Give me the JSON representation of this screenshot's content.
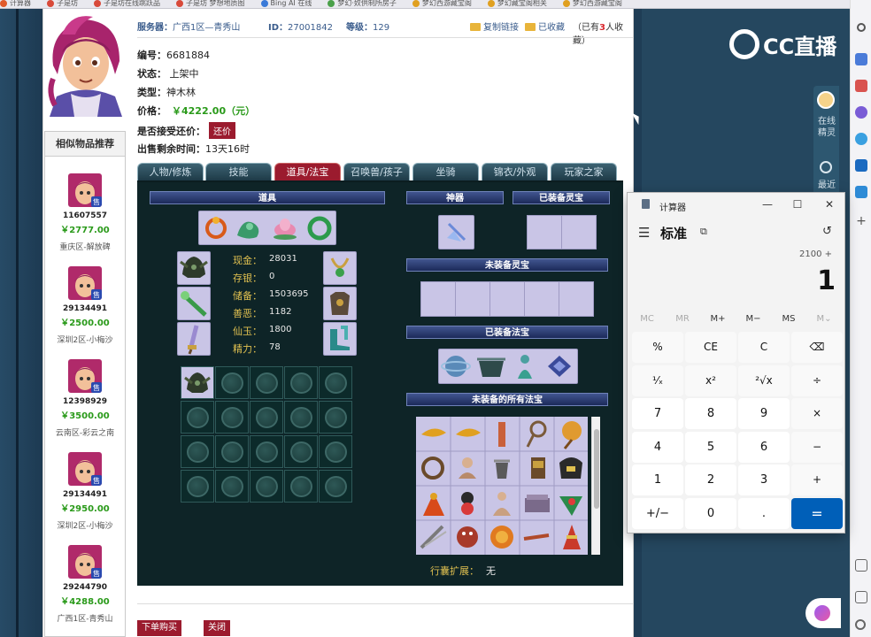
{
  "browser": {
    "bookmarks": [
      "计算器",
      "子是坊",
      "子是坊在线跳跃品",
      "子是坊 梦想地质图",
      "Bing AI 在线",
      "梦幻·奴供制所房子",
      "梦幻西游藏宝阁",
      "梦幻藏宝阁相关",
      "梦幻西游藏宝阁"
    ]
  },
  "listing": {
    "server_label": "服务器：",
    "server_value": "广西1区—青秀山",
    "id_label": "ID：",
    "id_value": "27001842",
    "level_label": "等级：",
    "level_value": "129",
    "copy_link": "复制链接",
    "favorited": "已收藏",
    "fav_prefix": "（已有",
    "fav_count": "3",
    "fav_suffix": "人收藏）",
    "serial_label": "编号：",
    "serial_value": "6681884",
    "status_label": "状态：",
    "status_value": "上架中",
    "type_label": "类型：",
    "type_value": "神木林",
    "price_label": "价格：",
    "price_value": "￥4222.00（元）",
    "counter_label": "是否接受还价：",
    "counter_button": "还价",
    "remain_label": "出售剩余时间：",
    "remain_value": "13天16时"
  },
  "recommend": {
    "title": "相似物品推荐",
    "badge": "售",
    "items": [
      {
        "id": "11607557",
        "price": "￥2777.00",
        "server": "重庆区-解放碑"
      },
      {
        "id": "29134491",
        "price": "￥2500.00",
        "server": "深圳2区-小梅沙"
      },
      {
        "id": "12398929",
        "price": "￥3500.00",
        "server": "云南区-彩云之南"
      },
      {
        "id": "29134491",
        "price": "￥2950.00",
        "server": "深圳2区-小梅沙"
      },
      {
        "id": "29244790",
        "price": "￥4288.00",
        "server": "广西1区-青秀山"
      }
    ]
  },
  "tabs": [
    "人物/修炼",
    "技能",
    "道具/法宝",
    "召唤兽/孩子",
    "坐骑",
    "锦衣/外观",
    "玩家之家"
  ],
  "active_tab": "道具/法宝",
  "game": {
    "items_bar": "道具",
    "shenqi_bar": "神器",
    "equipped_lingbao_bar": "已装备灵宝",
    "unequipped_lingbao_bar": "未装备灵宝",
    "equipped_fabao_bar": "已装备法宝",
    "all_fabao_bar": "未装备的所有法宝",
    "stats": [
      {
        "label": "现金：",
        "value": "28031"
      },
      {
        "label": "存银：",
        "value": "0"
      },
      {
        "label": "储备：",
        "value": "1503695"
      },
      {
        "label": "善恶：",
        "value": "1182"
      },
      {
        "label": "仙玉：",
        "value": "1800"
      },
      {
        "label": "精力：",
        "value": "78"
      }
    ],
    "ext_label": "行囊扩展：",
    "ext_value": "无"
  },
  "actions": {
    "buy": "下单购买",
    "close": "关闭"
  },
  "site": {
    "logo_text": "CC直播",
    "spirit_text": "在线精灵",
    "recent_text": "最近"
  },
  "calculator": {
    "title": "计算器",
    "mode": "标准",
    "expression": "2100 +",
    "display": "1",
    "memory": [
      "MC",
      "MR",
      "M+",
      "M−",
      "MS",
      "M⌄"
    ],
    "keys": [
      [
        "%",
        "CE",
        "C",
        "⌫"
      ],
      [
        "¹⁄ₓ",
        "x²",
        "²√x",
        "÷"
      ],
      [
        "7",
        "8",
        "9",
        "×"
      ],
      [
        "4",
        "5",
        "6",
        "−"
      ],
      [
        "1",
        "2",
        "3",
        "+"
      ],
      [
        "+/−",
        "0",
        ".",
        "="
      ]
    ]
  },
  "colors": {
    "price_green": "#2a9a1a",
    "accent_red": "#9b1b2e",
    "link_blue": "#3a5c8c",
    "game_bg": "#0e2427",
    "calc_equals": "#005fb8"
  }
}
